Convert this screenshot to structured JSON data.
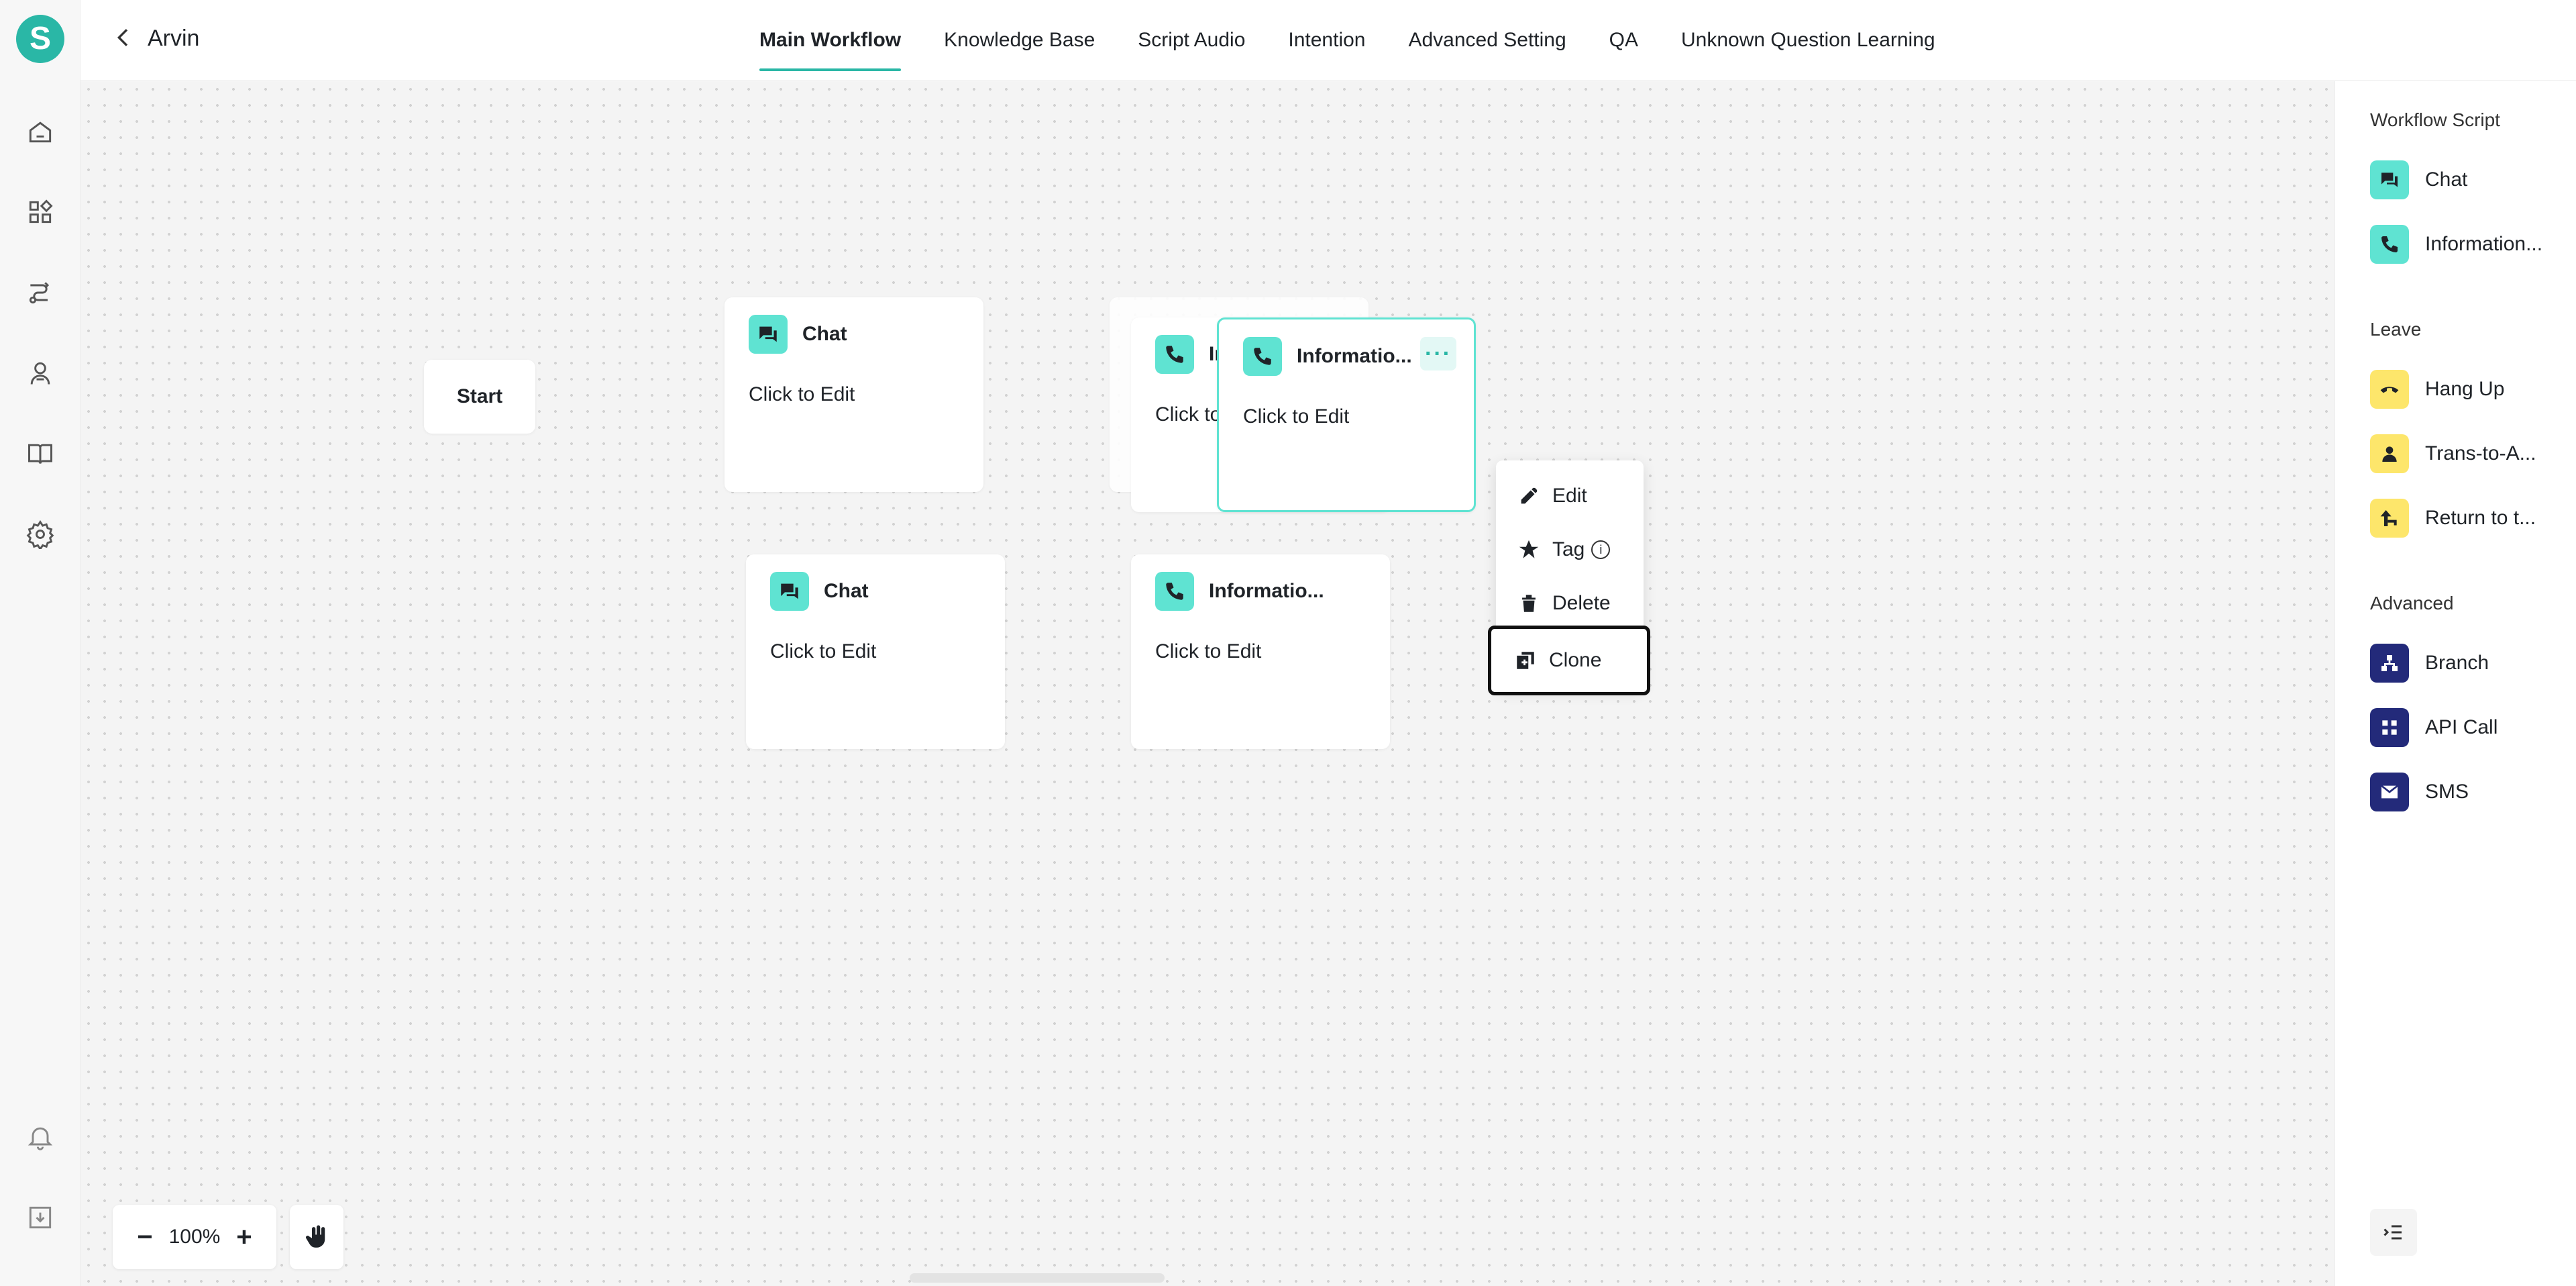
{
  "header": {
    "title": "Arvin",
    "tabs": [
      {
        "label": "Main Workflow",
        "active": true
      },
      {
        "label": "Knowledge Base"
      },
      {
        "label": "Script Audio"
      },
      {
        "label": "Intention"
      },
      {
        "label": "Advanced Setting"
      },
      {
        "label": "QA"
      },
      {
        "label": "Unknown Question Learning"
      }
    ]
  },
  "logo": {
    "letter": "S",
    "color": "#2ab7a6"
  },
  "rail": {
    "icons": [
      "home-icon",
      "apps-grid-icon",
      "route-icon",
      "agent-icon",
      "book-icon",
      "gear-icon",
      "bell-icon",
      "download-icon"
    ]
  },
  "canvas": {
    "start_label": "Start",
    "nodes": [
      {
        "title": "Chat",
        "subtitle": "Click to Edit",
        "icon": "chat-bubble-icon"
      },
      {
        "title": "Chat",
        "subtitle": "Click to Edit",
        "icon": "chat-bubble-icon"
      },
      {
        "title": "In",
        "subtitle": "Click to",
        "icon": "phone-icon"
      },
      {
        "title": "Informatio...",
        "subtitle": "Click to Edit",
        "icon": "phone-icon"
      },
      {
        "title": "Informatio...",
        "subtitle": "Click to Edit",
        "icon": "phone-icon"
      }
    ],
    "more_label": "···"
  },
  "context_menu": {
    "items": [
      {
        "label": "Edit",
        "icon": "pencil-icon"
      },
      {
        "label": "Tag",
        "icon": "star-icon",
        "info": "i"
      },
      {
        "label": "Delete",
        "icon": "trash-icon"
      },
      {
        "label": "Clone",
        "icon": "clone-icon"
      }
    ]
  },
  "zoom": {
    "minus": "−",
    "value": "100%",
    "plus": "+"
  },
  "panel": {
    "sections": [
      {
        "title": "Workflow Script",
        "items": [
          {
            "label": "Chat",
            "icon": "chat-bubble-icon",
            "color": "#5fe3d2"
          },
          {
            "label": "Information...",
            "icon": "phone-icon",
            "color": "#5fe3d2"
          }
        ]
      },
      {
        "title": "Leave",
        "items": [
          {
            "label": "Hang Up",
            "icon": "hang-up-icon",
            "color": "#fde66b"
          },
          {
            "label": "Trans-to-A...",
            "icon": "person-icon",
            "color": "#fde66b"
          },
          {
            "label": "Return to t...",
            "icon": "return-arrow-icon",
            "color": "#fde66b"
          }
        ]
      },
      {
        "title": "Advanced",
        "items": [
          {
            "label": "Branch",
            "icon": "branch-icon",
            "color": "#232a7a"
          },
          {
            "label": "API Call",
            "icon": "api-icon",
            "color": "#232a7a"
          },
          {
            "label": "SMS",
            "icon": "mail-icon",
            "color": "#232a7a"
          }
        ]
      }
    ]
  }
}
